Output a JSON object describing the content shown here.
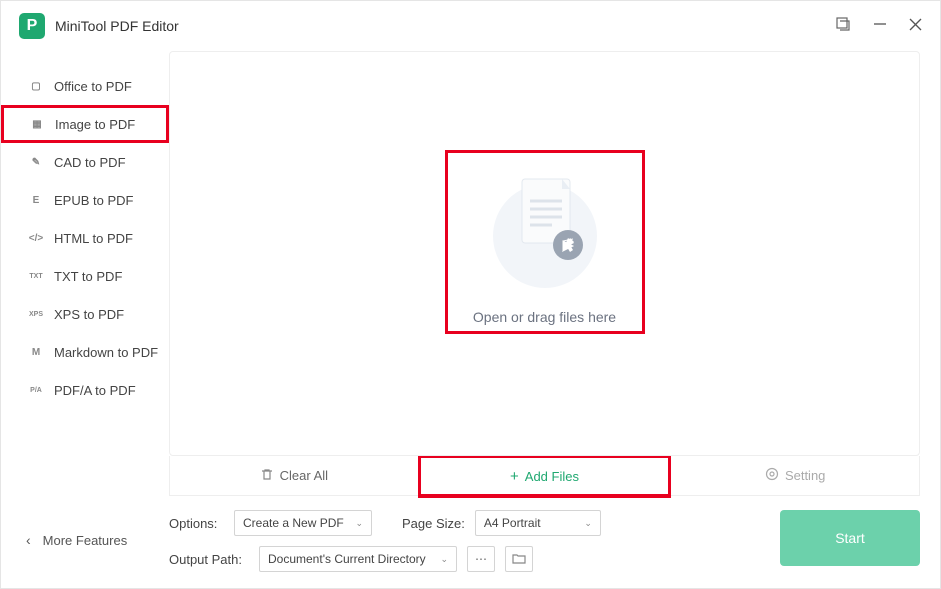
{
  "app": {
    "title": "MiniTool PDF Editor"
  },
  "sidebar": {
    "items": [
      {
        "label": "Office to PDF",
        "icon": "▢"
      },
      {
        "label": "Image to PDF",
        "icon": "▦"
      },
      {
        "label": "CAD to PDF",
        "icon": "✎"
      },
      {
        "label": "EPUB to PDF",
        "icon": "E"
      },
      {
        "label": "HTML to PDF",
        "icon": "</>"
      },
      {
        "label": "TXT to PDF",
        "icon": "TXT"
      },
      {
        "label": "XPS to PDF",
        "icon": "XPS"
      },
      {
        "label": "Markdown to PDF",
        "icon": "M"
      },
      {
        "label": "PDF/A to PDF",
        "icon": "P/A"
      }
    ],
    "more": "More Features"
  },
  "drop": {
    "text": "Open or drag files here"
  },
  "actions": {
    "clear": "Clear All",
    "add": "Add Files",
    "setting": "Setting"
  },
  "options": {
    "options_label": "Options:",
    "options_value": "Create a New PDF",
    "pagesize_label": "Page Size:",
    "pagesize_value": "A4 Portrait",
    "output_label": "Output Path:",
    "output_value": "Document's Current Directory"
  },
  "start": "Start"
}
